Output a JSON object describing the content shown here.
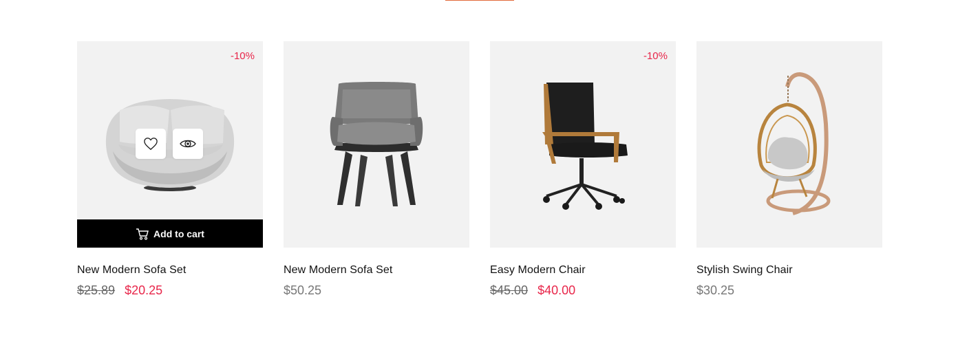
{
  "colors": {
    "accent": "#e2693a",
    "sale": "#e8264a",
    "cart_bar": "#000000",
    "card_bg": "#f2f2f2"
  },
  "products": [
    {
      "badge": "-10%",
      "title": "New Modern Sofa Set",
      "old_price": "$25.89",
      "price": "$20.25",
      "add_to_cart": "Add to cart",
      "icons": [
        "heart-icon",
        "eye-icon",
        "cart-icon"
      ]
    },
    {
      "title": "New Modern Sofa Set",
      "price": "$50.25"
    },
    {
      "badge": "-10%",
      "title": "Easy Modern Chair",
      "old_price": "$45.00",
      "price": "$40.00"
    },
    {
      "title": "Stylish Swing Chair",
      "price": "$30.25"
    }
  ]
}
